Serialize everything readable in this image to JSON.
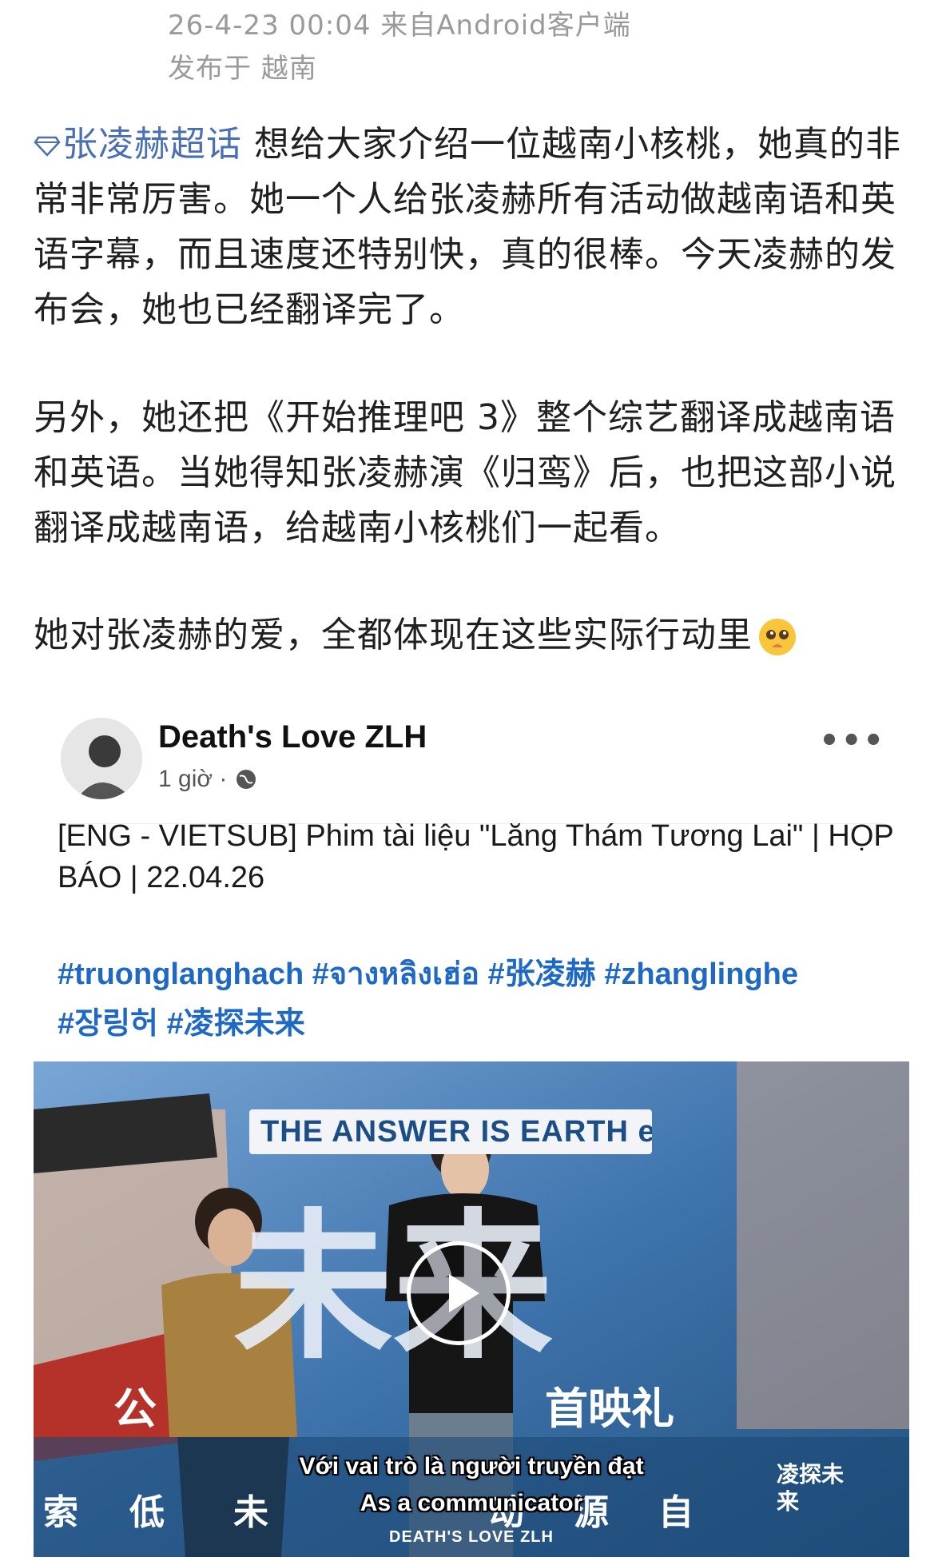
{
  "meta": {
    "timestamp_source": "26-4-23 00:04  来自Android客户端",
    "location": "发布于 越南"
  },
  "post": {
    "topic": "张凌赫超话",
    "paragraph1": "想给大家介绍一位越南小核桃，她真的非常非常厉害。她一个人给张凌赫所有活动做越南语和英语字幕，而且速度还特别快，真的很棒。今天凌赫的发布会，她也已经翻译完了。",
    "paragraph2": "另外，她还把《开始推理吧 3》整个综艺翻译成越南语和英语。当她得知张凌赫演《归鸾》后，也把这部小说翻译成越南语，给越南小核桃们一起看。",
    "paragraph3": "她对张凌赫的爱，全都体现在这些实际行动里",
    "emoji": "pleading-face"
  },
  "fb_card": {
    "name": "Death's Love ZLH",
    "time": "1 giờ ·",
    "title": "[ENG - VIETSUB] Phim tài liệu \"Lăng Thám Tương Lai\" | HỌP BÁO | 22.04.26",
    "hashtags_line1": "#truonglanghach #จางหลิงเฮ่อ #张凌赫 #zhanglinghe",
    "hashtags_line2": "#장링허 #凌探未来",
    "more_icon": "more-horizontal-icon",
    "globe_icon": "globe-icon"
  },
  "video": {
    "banner_text": "THE ANSWER IS EARTH e=",
    "subtitle_vi": "Với vai trò là người truyền đạt",
    "subtitle_en": "As a communicator",
    "watermark": "DEATH'S LOVE ZLH",
    "big_chars": "未来",
    "cn_line": "首映礼",
    "cn_left": "公",
    "bottom_chars": [
      "索",
      "低",
      "未",
      "动",
      "源",
      "自"
    ],
    "logo_text": "凌探未来",
    "play_icon": "play-icon",
    "colors": {
      "backdrop": "#3b6fa8",
      "hashtag": "#1f69c6",
      "topic": "#4a6fb5"
    }
  }
}
